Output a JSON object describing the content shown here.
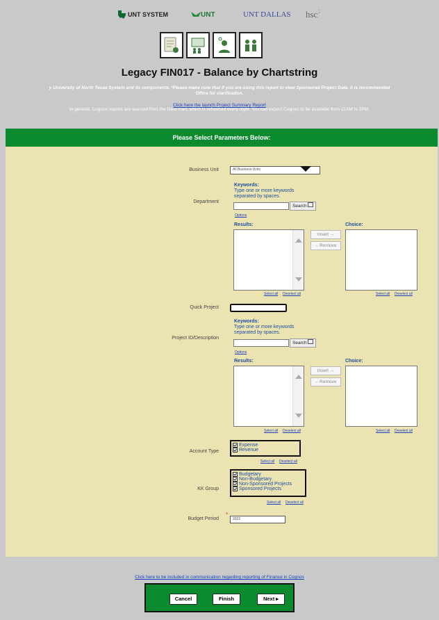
{
  "header": {
    "logos": [
      "UNT SYSTEM",
      "UNT",
      "UNT DALLAS",
      "hsc"
    ],
    "icons": [
      "report-document-icon",
      "presentation-icon",
      "person-chat-icon",
      "people-icon"
    ],
    "title": "Legacy FIN017 - Balance by Chartstring",
    "notice": "y University of North Texas System and its components. *Please make note that if you are using this report to view Sponsored Project Data, it is recommended",
    "notice2": "Office for clarification.",
    "project_summary_link": "Click here the launch Project Summary Report",
    "info": "In general, Cognos reports are sourced from the Data mart, which is refreshed every night. You can expect Cognos to be available from 12AM to 5PM."
  },
  "section_title": "Please Select Parameters Below:",
  "params": {
    "business_unit": {
      "label": "Business Unit",
      "value": "All Business Units"
    },
    "department": {
      "label": "Department",
      "keywords_title": "Keywords:",
      "keywords_hint": "Type one or more keywords separated by spaces.",
      "search_label": "Search",
      "options_label": "Options",
      "results_label": "Results:",
      "choice_label": "Choice:",
      "insert_label": "Insert",
      "remove_label": "Remove",
      "select_all": "Select all",
      "deselect_all": "Deselect all"
    },
    "quick_project": {
      "label": "Quick Project"
    },
    "project_id": {
      "label": "Project ID/Description",
      "keywords_title": "Keywords:",
      "keywords_hint": "Type one or more keywords separated by spaces.",
      "search_label": "Search",
      "options_label": "Options",
      "results_label": "Results:",
      "choice_label": "Choice:",
      "insert_label": "Insert",
      "remove_label": "Remove",
      "select_all": "Select all",
      "deselect_all": "Deselect all"
    },
    "account_type": {
      "label": "Account Type",
      "options": [
        "Expense",
        "Revenue"
      ],
      "select_all": "Select all",
      "deselect_all": "Deselect all"
    },
    "kk_group": {
      "label": "KK Group",
      "options": [
        "Budgetary",
        "Non-Budgetary",
        "Non-Sponsored Projects",
        "Sponsored Projects"
      ],
      "select_all": "Select all",
      "deselect_all": "Deselect all"
    },
    "budget_period": {
      "label": "Budget Period",
      "value": "2022",
      "required_mark": "*"
    }
  },
  "bottom_link": "Click here to be included in communication regarding reporting of Finance in Cognos",
  "footer": {
    "cancel": "Cancel",
    "finish": "Finish",
    "next": "Next ▸"
  },
  "colors": {
    "green": "#0a8a2e",
    "panel": "#ece3b3",
    "page": "#c9c9c9",
    "link": "#1a3fbf"
  }
}
